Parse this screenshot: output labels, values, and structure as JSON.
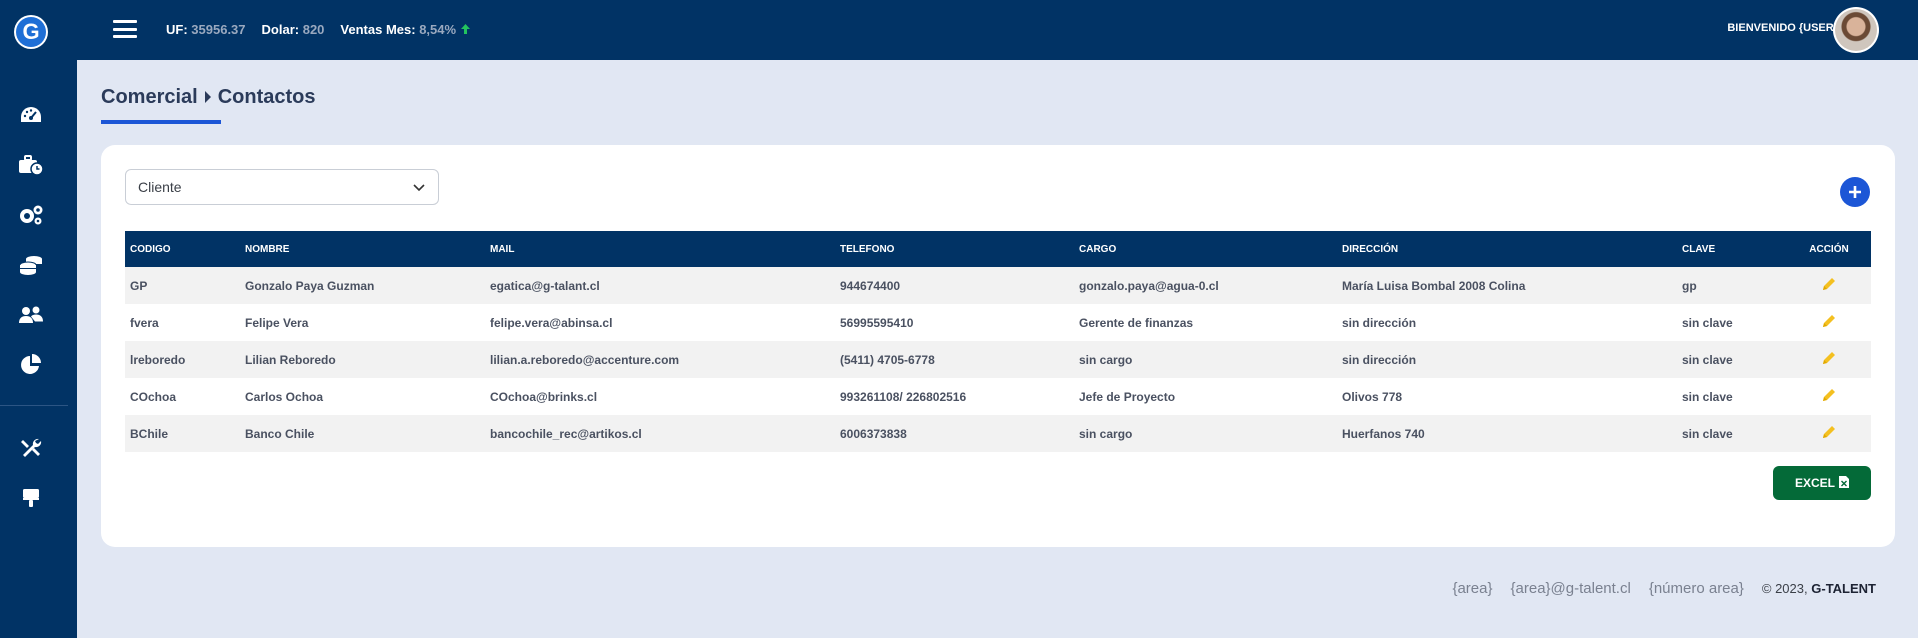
{
  "header": {
    "uf_label": "UF:",
    "uf_value": "35956.37",
    "dolar_label": "Dolar:",
    "dolar_value": "820",
    "ventas_label": "Ventas Mes:",
    "ventas_value": "8,54%",
    "ventas_trend_icon": "arrow-up-icon",
    "welcome": "BIENVENIDO {USER}"
  },
  "sidebar": {
    "logo_letter": "G",
    "items": [
      {
        "icon": "dashboard-gauge-icon"
      },
      {
        "icon": "briefcase-clock-icon"
      },
      {
        "icon": "gears-icon"
      },
      {
        "icon": "coins-stack-icon"
      },
      {
        "icon": "users-icon"
      },
      {
        "icon": "pie-chart-icon"
      },
      {
        "icon": "tools-icon"
      },
      {
        "icon": "paint-roller-icon"
      }
    ]
  },
  "breadcrumb": {
    "section": "Comercial",
    "page": "Contactos"
  },
  "filter": {
    "selected": "Cliente"
  },
  "table": {
    "headers": [
      "CODIGO",
      "NOMBRE",
      "MAIL",
      "TELEFONO",
      "CARGO",
      "DIRECCIÓN",
      "CLAVE",
      "ACCIÓN"
    ],
    "rows": [
      {
        "codigo": "GP",
        "nombre": "Gonzalo Paya Guzman",
        "mail": "egatica@g-talant.cl",
        "telefono": "944674400",
        "cargo": "gonzalo.paya@agua-0.cl",
        "direccion": "María Luisa Bombal 2008 Colina",
        "clave": "gp"
      },
      {
        "codigo": "fvera",
        "nombre": "Felipe Vera",
        "mail": "felipe.vera@abinsa.cl",
        "telefono": "56995595410",
        "cargo": "Gerente de finanzas",
        "direccion": "sin dirección",
        "clave": "sin clave"
      },
      {
        "codigo": "lreboredo",
        "nombre": "Lilian Reboredo",
        "mail": "lilian.a.reboredo@accenture.com",
        "telefono": "(5411) 4705-6778",
        "cargo": "sin cargo",
        "direccion": "sin dirección",
        "clave": "sin clave"
      },
      {
        "codigo": "COchoa",
        "nombre": "Carlos Ochoa",
        "mail": "COchoa@brinks.cl",
        "telefono": "993261108/ 226802516",
        "cargo": "Jefe de Proyecto",
        "direccion": "Olivos 778",
        "clave": "sin clave"
      },
      {
        "codigo": "BChile",
        "nombre": "Banco Chile",
        "mail": "bancochile_rec@artikos.cl",
        "telefono": "6006373838",
        "cargo": "sin cargo",
        "direccion": "Huerfanos 740",
        "clave": "sin clave"
      }
    ]
  },
  "excel_button": {
    "label": "EXCEL"
  },
  "footer": {
    "area": "{area}",
    "email": "{area}@g-talent.cl",
    "phone": "{número area}",
    "copyright": "© 2023,",
    "brand": "G-TALENT"
  },
  "colors": {
    "navy": "#013365",
    "accent_blue": "#1c56d6",
    "excel_green": "#046a38",
    "edit_yellow": "#f4c020"
  }
}
